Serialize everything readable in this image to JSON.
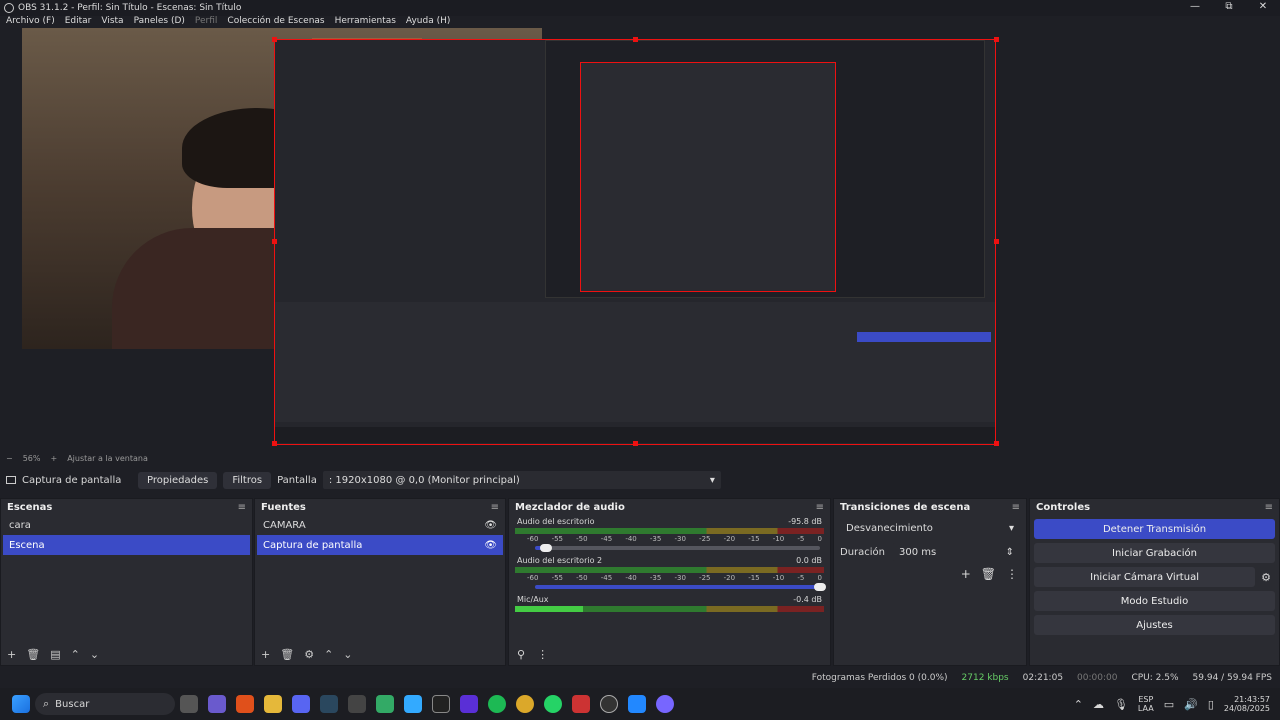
{
  "window": {
    "title": "OBS 31.1.2 - Perfil: Sin Título - Escenas: Sin Título",
    "minimize": "—",
    "maximize": "⧉",
    "close": "✕"
  },
  "menu": [
    "Archivo (F)",
    "Editar",
    "Vista",
    "Paneles (D)",
    "Perfil",
    "Colección de Escenas",
    "Herramientas",
    "Ayuda (H)"
  ],
  "zoom": {
    "minus": "−",
    "value": "56%",
    "plus": "+",
    "fit": "Ajustar a la ventana"
  },
  "source_bar": {
    "source": "Captura de pantalla",
    "properties": "Propiedades",
    "filters": "Filtros",
    "screen_label": "Pantalla",
    "screen_value": ": 1920x1080 @ 0,0 (Monitor principal)"
  },
  "scenes": {
    "title": "Escenas",
    "items": [
      "cara",
      "Escena"
    ],
    "active": "Escena"
  },
  "sources": {
    "title": "Fuentes",
    "items": [
      "CAMARA",
      "Captura de pantalla"
    ],
    "active": "Captura de pantalla"
  },
  "mixer": {
    "title": "Mezclador de audio",
    "ticks": [
      "-60",
      "-55",
      "-50",
      "-45",
      "-40",
      "-35",
      "-30",
      "-25",
      "-20",
      "-15",
      "-10",
      "-5",
      "0"
    ],
    "channels": [
      {
        "name": "Audio del escritorio",
        "db": "-95.8 dB",
        "level": 0.0
      },
      {
        "name": "Audio del escritorio 2",
        "db": "0.0 dB",
        "level": 1.0
      },
      {
        "name": "Mic/Aux",
        "db": "-0.4 dB",
        "level": 0.3
      }
    ]
  },
  "transitions": {
    "title": "Transiciones de escena",
    "type": "Desvanecimiento",
    "duration_label": "Duración",
    "duration": "300 ms"
  },
  "controls": {
    "title": "Controles",
    "buttons": [
      "Detener Transmisión",
      "Iniciar Grabación",
      "Iniciar Cámara Virtual",
      "Modo Estudio",
      "Ajustes"
    ]
  },
  "status": {
    "dropped": "Fotogramas Perdidos 0 (0.0%)",
    "kbps": "2712 kbps",
    "stream_time": "02:21:05",
    "rec_time": "00:00:00",
    "cpu": "CPU: 2.5%",
    "fps": "59.94 / 59.94 FPS"
  },
  "taskbar": {
    "search": "Buscar",
    "lang1": "ESP",
    "lang2": "LAA",
    "time": "21:43:57",
    "date": "24/08/2025"
  },
  "colors": {
    "accent": "#3b4bc6",
    "selection": "#e11111"
  }
}
